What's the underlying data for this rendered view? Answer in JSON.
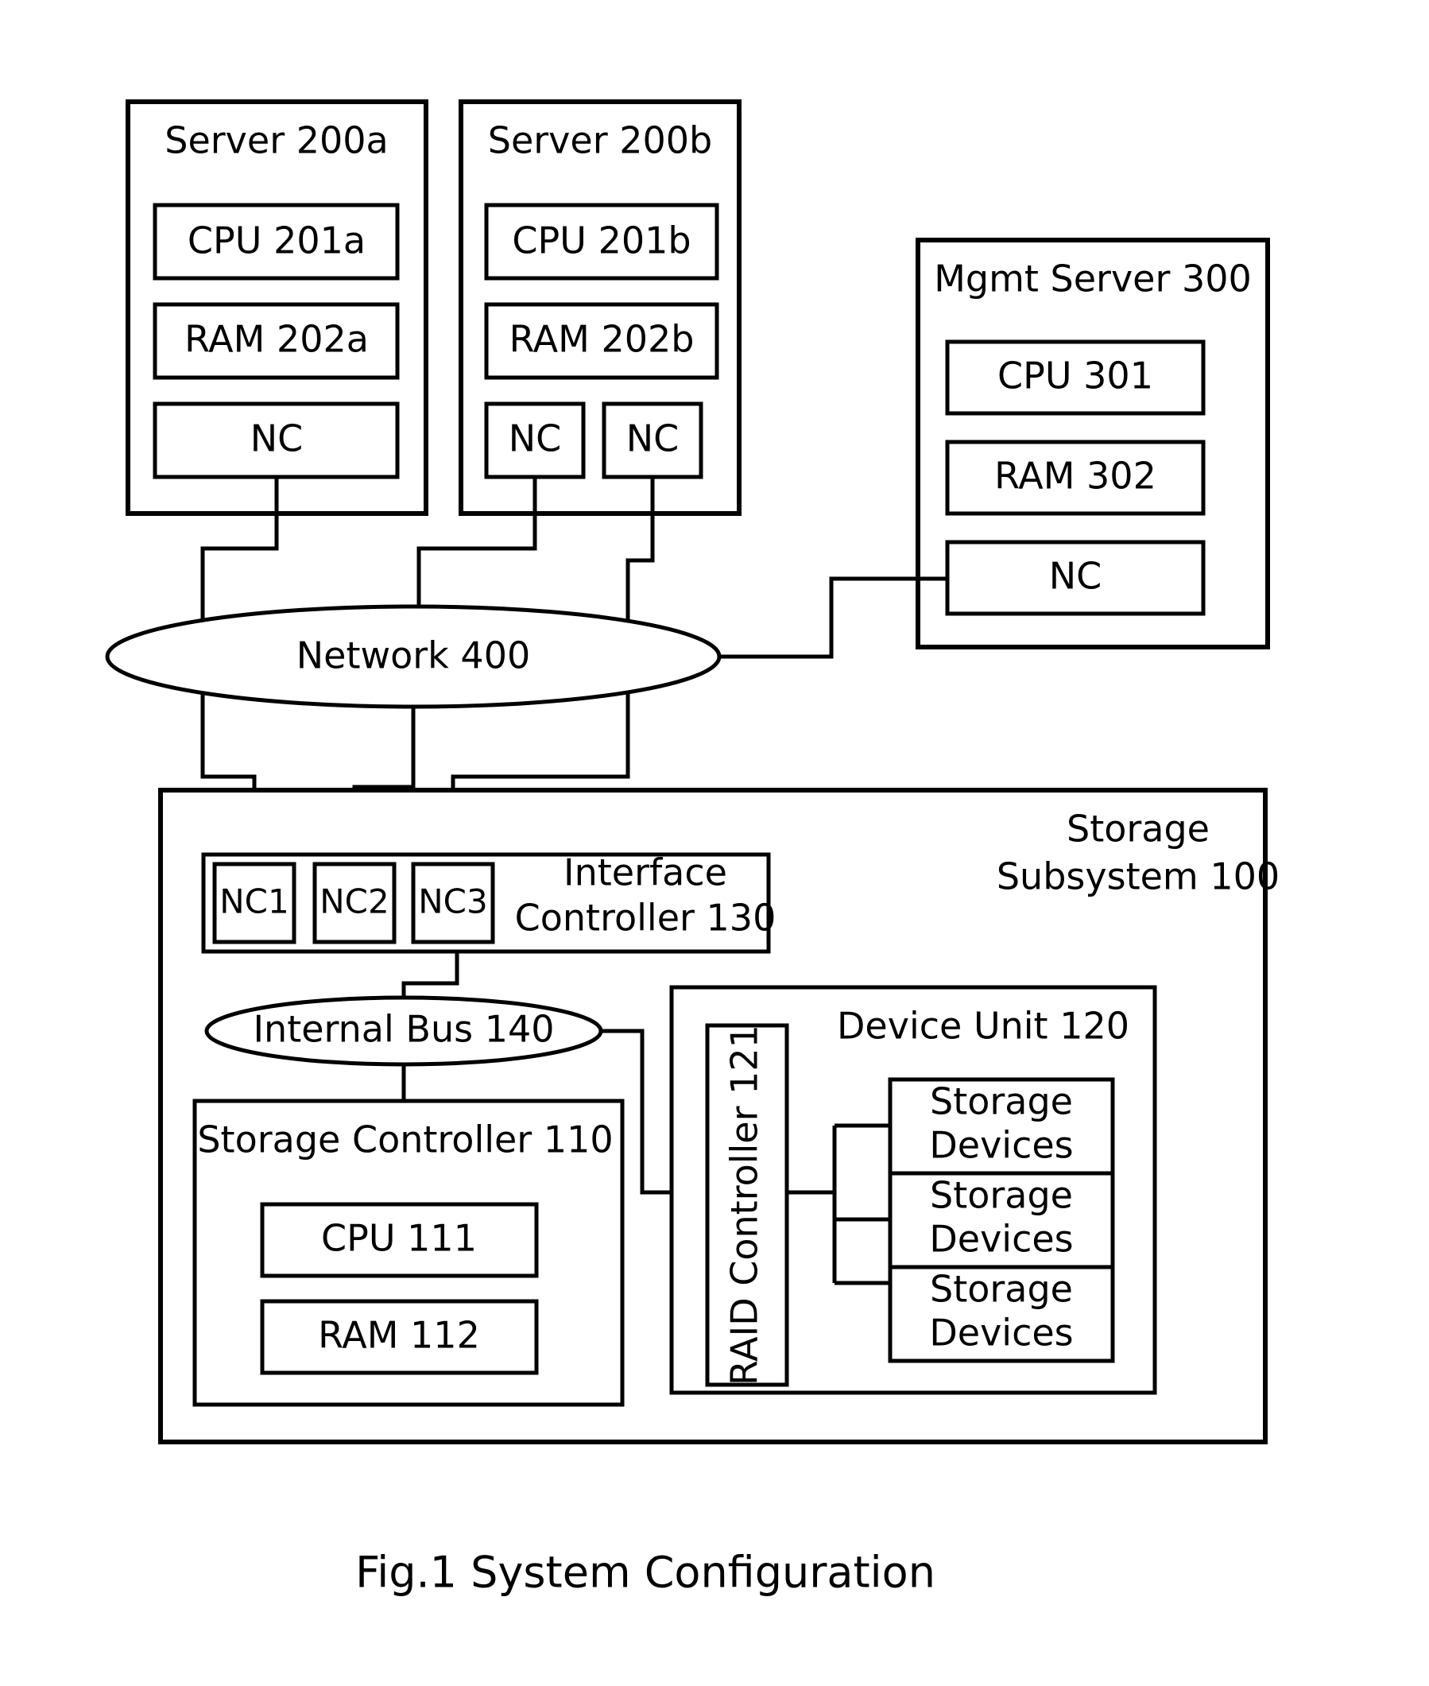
{
  "figure": {
    "caption": "Fig.1 System Configuration"
  },
  "servers": [
    {
      "title": "Server 200a",
      "cpu": "CPU 201a",
      "ram": "RAM 202a",
      "nics": [
        "NC"
      ]
    },
    {
      "title": "Server 200b",
      "cpu": "CPU 201b",
      "ram": "RAM 202b",
      "nics": [
        "NC",
        "NC"
      ]
    }
  ],
  "mgmt_server": {
    "title": "Mgmt Server 300",
    "cpu": "CPU 301",
    "ram": "RAM 302",
    "nic": "NC"
  },
  "network": {
    "label": "Network 400"
  },
  "storage_subsystem": {
    "title_line1": "Storage",
    "title_line2": "Subsystem 100",
    "interface_controller": {
      "title_line1": "Interface",
      "title_line2": "Controller 130",
      "nics": [
        "NC1",
        "NC2",
        "NC3"
      ]
    },
    "internal_bus": {
      "label": "Internal Bus 140"
    },
    "storage_controller": {
      "title": "Storage Controller 110",
      "cpu": "CPU 111",
      "ram": "RAM 112"
    },
    "device_unit": {
      "title": "Device Unit 120",
      "raid_controller": "RAID Controller 121",
      "storage_devices": [
        {
          "line1": "Storage",
          "line2": "Devices"
        },
        {
          "line1": "Storage",
          "line2": "Devices"
        },
        {
          "line1": "Storage",
          "line2": "Devices"
        }
      ]
    }
  },
  "colors": {
    "stroke": "#000000",
    "background": "#ffffff"
  }
}
